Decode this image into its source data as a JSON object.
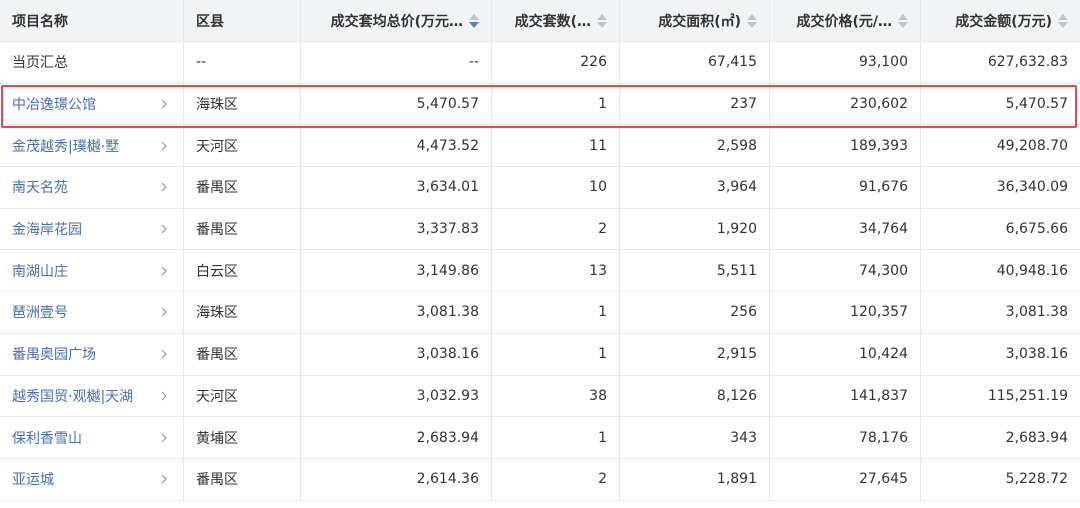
{
  "headers": {
    "name": "项目名称",
    "district": "区县",
    "avg_total": "成交套均总价(万元…",
    "units": "成交套数(…",
    "area": "成交面积(㎡)",
    "price": "成交价格(元/…",
    "amount": "成交金额(万元)"
  },
  "summary": {
    "name": "当页汇总",
    "district": "--",
    "avg_total": "--",
    "units": "226",
    "area": "67,415",
    "price": "93,100",
    "amount": "627,632.83"
  },
  "rows": [
    {
      "name": "中冶逸璟公馆",
      "district": "海珠区",
      "avg_total": "5,470.57",
      "units": "1",
      "area": "237",
      "price": "230,602",
      "amount": "5,470.57"
    },
    {
      "name": "金茂越秀|璞樾·墅",
      "district": "天河区",
      "avg_total": "4,473.52",
      "units": "11",
      "area": "2,598",
      "price": "189,393",
      "amount": "49,208.70"
    },
    {
      "name": "南天名苑",
      "district": "番禺区",
      "avg_total": "3,634.01",
      "units": "10",
      "area": "3,964",
      "price": "91,676",
      "amount": "36,340.09"
    },
    {
      "name": "金海岸花园",
      "district": "番禺区",
      "avg_total": "3,337.83",
      "units": "2",
      "area": "1,920",
      "price": "34,764",
      "amount": "6,675.66"
    },
    {
      "name": "南湖山庄",
      "district": "白云区",
      "avg_total": "3,149.86",
      "units": "13",
      "area": "5,511",
      "price": "74,300",
      "amount": "40,948.16"
    },
    {
      "name": "琶洲壹号",
      "district": "海珠区",
      "avg_total": "3,081.38",
      "units": "1",
      "area": "256",
      "price": "120,357",
      "amount": "3,081.38"
    },
    {
      "name": "番禺奥园广场",
      "district": "番禺区",
      "avg_total": "3,038.16",
      "units": "1",
      "area": "2,915",
      "price": "10,424",
      "amount": "3,038.16"
    },
    {
      "name": "越秀国贸·观樾|天湖",
      "district": "天河区",
      "avg_total": "3,032.93",
      "units": "38",
      "area": "8,126",
      "price": "141,837",
      "amount": "115,251.19"
    },
    {
      "name": "保利香雪山",
      "district": "黄埔区",
      "avg_total": "2,683.94",
      "units": "1",
      "area": "343",
      "price": "78,176",
      "amount": "2,683.94"
    },
    {
      "name": "亚运城",
      "district": "番禺区",
      "avg_total": "2,614.36",
      "units": "2",
      "area": "1,891",
      "price": "27,645",
      "amount": "5,228.72"
    }
  ],
  "colors": {
    "link": "#4a6fad",
    "highlight_border": "#e34948",
    "header_bg": "#f2f3f5",
    "sort_active": "#5b7fbf"
  },
  "icons": {
    "row_action": "chevron-right-icon",
    "sort": "sort-caret-icon"
  }
}
